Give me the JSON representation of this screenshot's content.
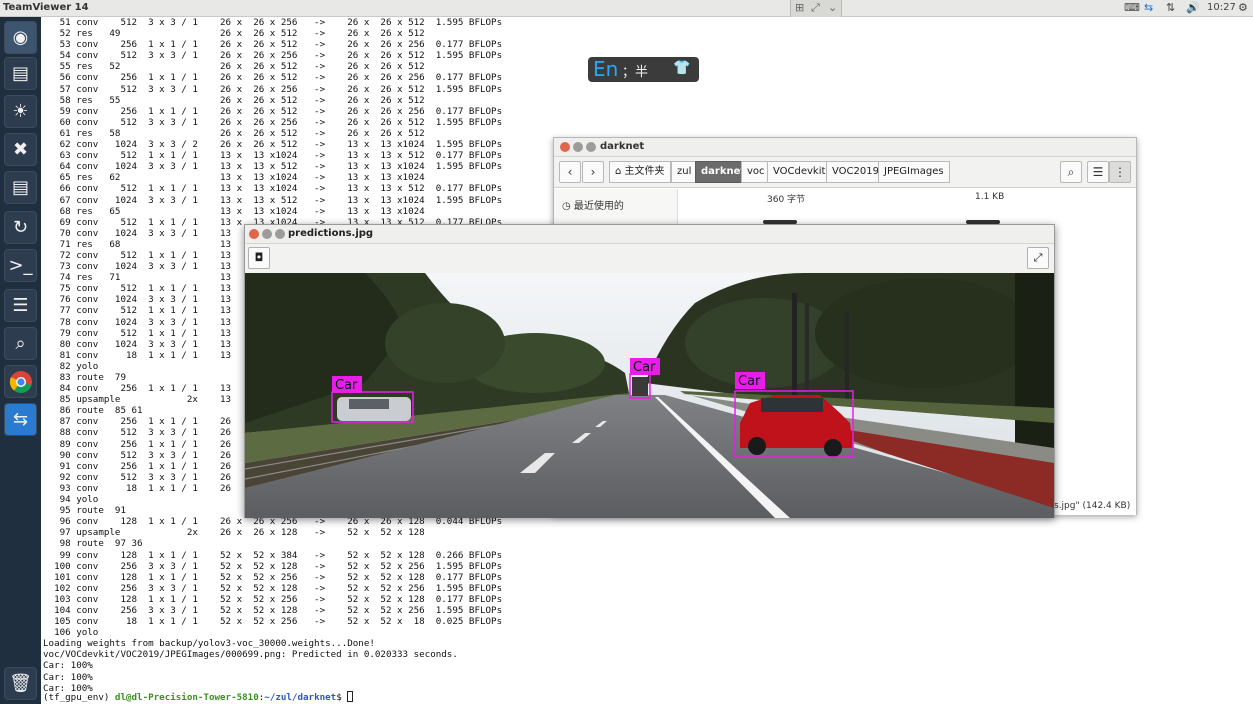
{
  "window": {
    "title": "TeamViewer 14"
  },
  "tray": {
    "clock": "10:27"
  },
  "colors": {
    "launcher_bg": "#1f2f40",
    "detection": "#e81de8",
    "prompt_user": "#3a8f1f",
    "prompt_path": "#2d56c4"
  },
  "ime": {
    "lang": "En",
    "rest": "；半"
  },
  "terminal": {
    "lines": [
      "   51 conv    512  3 x 3 / 1    26 x  26 x 256   ->    26 x  26 x 512  1.595 BFLOPs",
      "   52 res   49                  26 x  26 x 512   ->    26 x  26 x 512",
      "   53 conv    256  1 x 1 / 1    26 x  26 x 512   ->    26 x  26 x 256  0.177 BFLOPs",
      "   54 conv    512  3 x 3 / 1    26 x  26 x 256   ->    26 x  26 x 512  1.595 BFLOPs",
      "   55 res   52                  26 x  26 x 512   ->    26 x  26 x 512",
      "   56 conv    256  1 x 1 / 1    26 x  26 x 512   ->    26 x  26 x 256  0.177 BFLOPs",
      "   57 conv    512  3 x 3 / 1    26 x  26 x 256   ->    26 x  26 x 512  1.595 BFLOPs",
      "   58 res   55                  26 x  26 x 512   ->    26 x  26 x 512",
      "   59 conv    256  1 x 1 / 1    26 x  26 x 512   ->    26 x  26 x 256  0.177 BFLOPs",
      "   60 conv    512  3 x 3 / 1    26 x  26 x 256   ->    26 x  26 x 512  1.595 BFLOPs",
      "   61 res   58                  26 x  26 x 512   ->    26 x  26 x 512",
      "   62 conv   1024  3 x 3 / 2    26 x  26 x 512   ->    13 x  13 x1024  1.595 BFLOPs",
      "   63 conv    512  1 x 1 / 1    13 x  13 x1024   ->    13 x  13 x 512  0.177 BFLOPs",
      "   64 conv   1024  3 x 3 / 1    13 x  13 x 512   ->    13 x  13 x1024  1.595 BFLOPs",
      "   65 res   62                  13 x  13 x1024   ->    13 x  13 x1024",
      "   66 conv    512  1 x 1 / 1    13 x  13 x1024   ->    13 x  13 x 512  0.177 BFLOPs",
      "   67 conv   1024  3 x 3 / 1    13 x  13 x 512   ->    13 x  13 x1024  1.595 BFLOPs",
      "   68 res   65                  13 x  13 x1024   ->    13 x  13 x1024",
      "   69 conv    512  1 x 1 / 1    13 x  13 x1024   ->    13 x  13 x 512  0.177 BFLOPs",
      "   70 conv   1024  3 x 3 / 1    13",
      "   71 res   68                  13",
      "   72 conv    512  1 x 1 / 1    13",
      "   73 conv   1024  3 x 3 / 1    13",
      "   74 res   71                  13",
      "   75 conv    512  1 x 1 / 1    13",
      "   76 conv   1024  3 x 3 / 1    13",
      "   77 conv    512  1 x 1 / 1    13",
      "   78 conv   1024  3 x 3 / 1    13",
      "   79 conv    512  1 x 1 / 1    13",
      "   80 conv   1024  3 x 3 / 1    13",
      "   81 conv     18  1 x 1 / 1    13",
      "   82 yolo",
      "   83 route  79",
      "   84 conv    256  1 x 1 / 1    13",
      "   85 upsample            2x    13",
      "   86 route  85 61",
      "   87 conv    256  1 x 1 / 1    26",
      "   88 conv    512  3 x 3 / 1    26",
      "   89 conv    256  1 x 1 / 1    26",
      "   90 conv    512  3 x 3 / 1    26",
      "   91 conv    256  1 x 1 / 1    26",
      "   92 conv    512  3 x 3 / 1    26",
      "   93 conv     18  1 x 1 / 1    26",
      "   94 yolo",
      "   95 route  91",
      "   96 conv    128  1 x 1 / 1    26 x  26 x 256   ->    26 x  26 x 128  0.044 BFLOPs",
      "   97 upsample            2x    26 x  26 x 128   ->    52 x  52 x 128",
      "   98 route  97 36",
      "   99 conv    128  1 x 1 / 1    52 x  52 x 384   ->    52 x  52 x 128  0.266 BFLOPs",
      "  100 conv    256  3 x 3 / 1    52 x  52 x 128   ->    52 x  52 x 256  1.595 BFLOPs",
      "  101 conv    128  1 x 1 / 1    52 x  52 x 256   ->    52 x  52 x 128  0.177 BFLOPs",
      "  102 conv    256  3 x 3 / 1    52 x  52 x 128   ->    52 x  52 x 256  1.595 BFLOPs",
      "  103 conv    128  1 x 1 / 1    52 x  52 x 256   ->    52 x  52 x 128  0.177 BFLOPs",
      "  104 conv    256  3 x 3 / 1    52 x  52 x 128   ->    52 x  52 x 256  1.595 BFLOPs",
      "  105 conv     18  1 x 1 / 1    52 x  52 x 256   ->    52 x  52 x  18  0.025 BFLOPs",
      "  106 yolo",
      "Loading weights from backup/yolov3-voc_30000.weights...Done!",
      "voc/VOCdevkit/VOC2019/JPEGImages/000699.png: Predicted in 0.020333 seconds.",
      "Car: 100%",
      "Car: 100%",
      "Car: 100%"
    ],
    "prompt": {
      "env": "(tf_gpu_env) ",
      "user": "dl@dl-Precision-Tower-5810",
      "sep": ":",
      "path": "~/zul/darknet",
      "tail": "$ "
    }
  },
  "file_manager": {
    "title": "darknet",
    "breadcrumbs": [
      "主文件夹",
      "zul",
      "darknet",
      "voc",
      "VOCdevkit",
      "VOC2019",
      "JPEGImages"
    ],
    "active_crumb": "darknet",
    "sidebar": {
      "recent": "最近使用的"
    },
    "sizes": [
      "360 字节",
      "1.1 KB"
    ],
    "status": "s.jpg\" (142.4 KB)"
  },
  "image_viewer": {
    "title": "predictions.jpg",
    "detections": [
      {
        "label": "Car"
      },
      {
        "label": "Car"
      },
      {
        "label": "Car"
      }
    ]
  }
}
